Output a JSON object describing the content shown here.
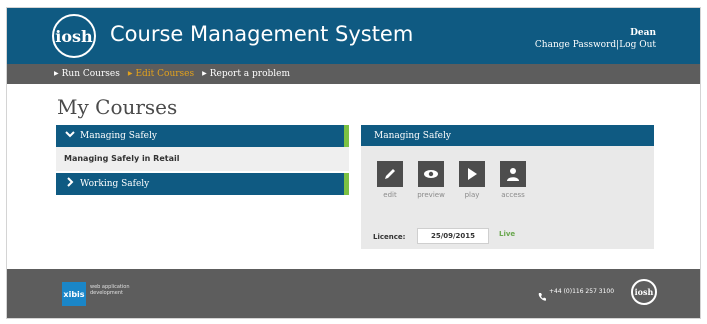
{
  "header": {
    "logo_text": "iosh",
    "app_title": "Course Management System",
    "user": {
      "name": "Dean",
      "change_password": "Change Password",
      "separator": "|",
      "log_out": "Log Out"
    }
  },
  "nav": {
    "items": [
      {
        "label": "Run Courses",
        "active": false
      },
      {
        "label": "Edit Courses",
        "active": true
      },
      {
        "label": "Report a problem",
        "active": false
      }
    ]
  },
  "page": {
    "title": "My Courses"
  },
  "courses": [
    {
      "label": "Managing Safely",
      "expanded": true,
      "children": [
        "Managing Safely in Retail"
      ]
    },
    {
      "label": "Working Safely",
      "expanded": false,
      "children": []
    }
  ],
  "panel": {
    "title": "Managing Safely",
    "actions": [
      {
        "label": "edit",
        "icon": "pencil-icon"
      },
      {
        "label": "preview",
        "icon": "eye-icon"
      },
      {
        "label": "play",
        "icon": "play-icon"
      },
      {
        "label": "access",
        "icon": "user-icon"
      }
    ],
    "licence_label": "Licence:",
    "licence_date": "25/09/2015",
    "status": "Live"
  },
  "footer": {
    "xibis_name": "xibis",
    "xibis_tagline": "web application development",
    "phone": "+44 (0)116 257 3100",
    "logo_text": "iosh"
  },
  "colors": {
    "brand_blue": "#0f5a82",
    "nav_grey": "#5d5d5d",
    "accent_orange": "#e3a21c",
    "accent_green": "#7cc143",
    "live_green": "#6aa84f"
  }
}
